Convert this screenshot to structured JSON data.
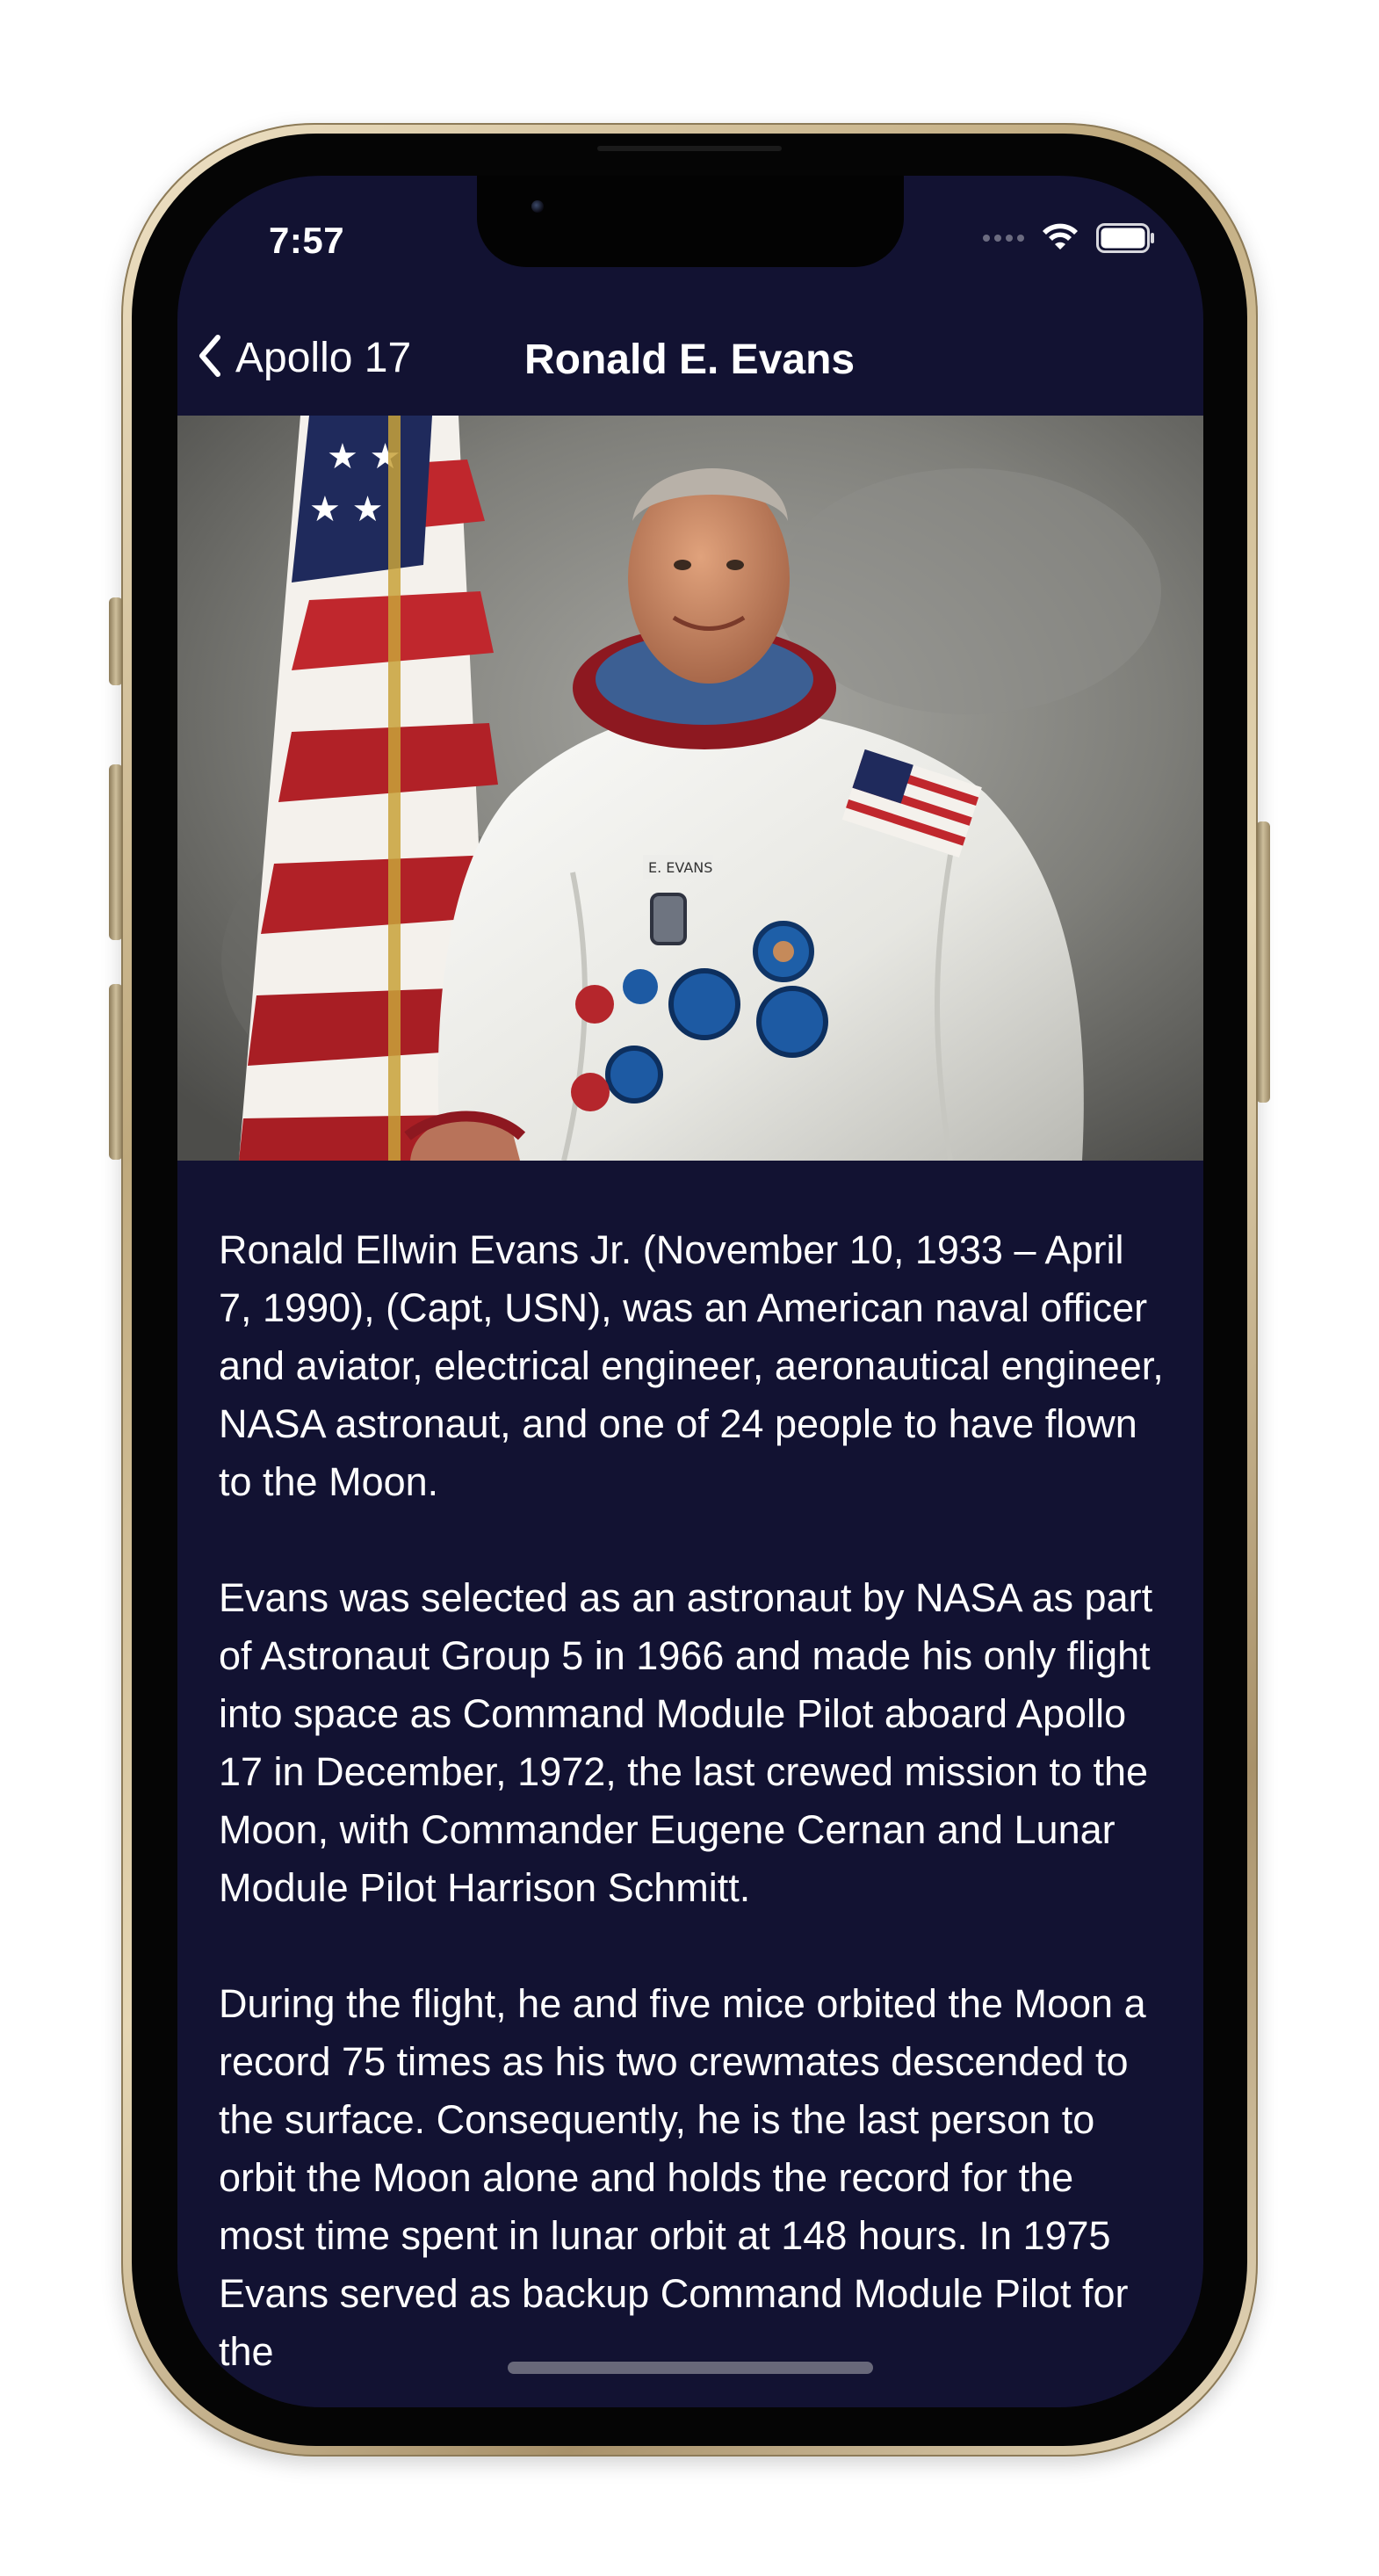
{
  "status_bar": {
    "time": "7:57",
    "icons": [
      "signal-dots-icon",
      "wifi-icon",
      "battery-icon"
    ]
  },
  "nav": {
    "back_label": "Apollo 17",
    "title": "Ronald E. Evans"
  },
  "photo": {
    "subject": "astronaut-portrait",
    "name_tag": "E. EVANS"
  },
  "bio": {
    "paragraphs": [
      "Ronald Ellwin Evans Jr. (November 10, 1933 – April 7, 1990), (Capt, USN), was an American naval officer and aviator, electrical engineer, aeronautical engineer, NASA astronaut, and one of 24 people to have flown to the Moon.",
      "Evans was selected as an astronaut by NASA as part of Astronaut Group 5 in 1966 and made his only flight into space as Command Module Pilot aboard Apollo 17 in December, 1972, the last crewed mission to the Moon, with Commander Eugene Cernan and Lunar Module Pilot Harrison Schmitt.",
      "During the flight, he and five mice orbited the Moon a record 75 times as his two crewmates descended to the surface. Consequently, he is the last person to orbit the Moon alone and holds the record for the most time spent in lunar orbit at 148 hours. In 1975 Evans served as backup Command Module Pilot for the"
    ]
  },
  "colors": {
    "background": "#121232",
    "text": "#ffffff",
    "frame_gold": "#d9c9a4"
  }
}
